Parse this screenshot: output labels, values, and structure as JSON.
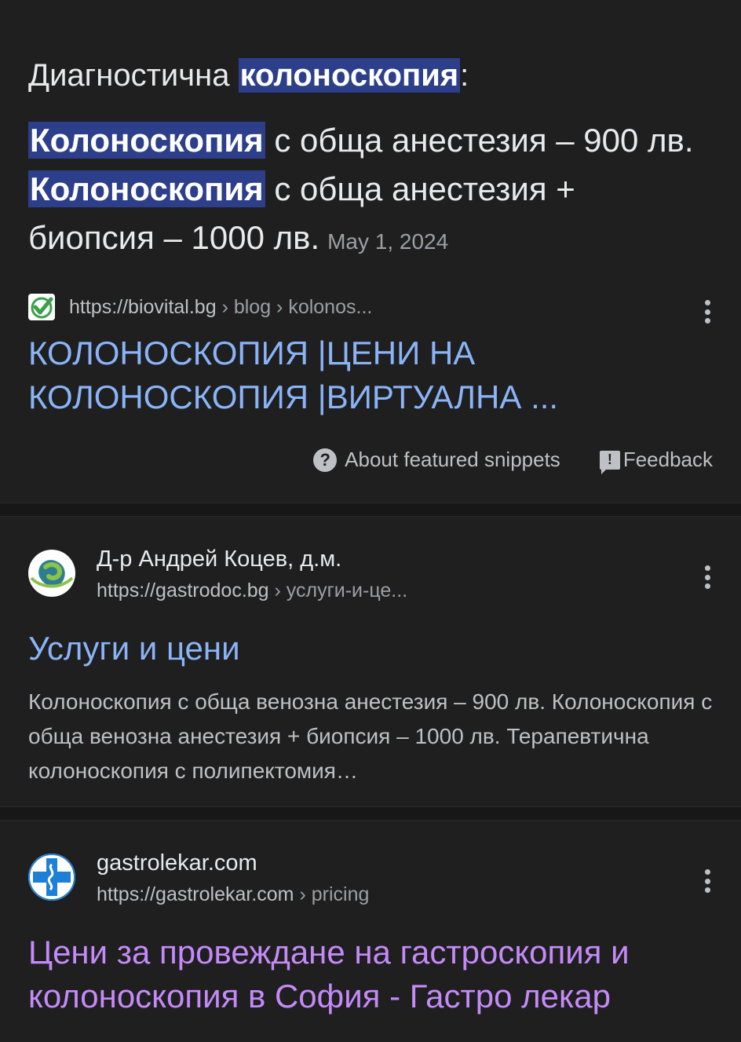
{
  "featured": {
    "heading_prefix": "Диагностична ",
    "heading_hl": "колоноскопия",
    "heading_suffix": ":",
    "answer_hl1": "Колоноскопия",
    "answer_t1": " с обща анестезия – 900 лв. ",
    "answer_hl2": "Колоноскопия",
    "answer_t2": " с обща анестезия + биопсия – 1000 лв.",
    "date": "May 1, 2024",
    "source_url": "https://biovital.bg",
    "source_path": " › blog › kolonos...",
    "title": "КОЛОНОСКОПИЯ |ЦЕНИ НА КОЛОНОСКОПИЯ |ВИРТУАЛНА ...",
    "about_label": "About featured snippets",
    "feedback_label": "Feedback"
  },
  "results": [
    {
      "site_name": "Д-р Андрей Коцев, д.м.",
      "url": "https://gastrodoc.bg",
      "path": " › услуги-и-це...",
      "title": "Услуги и цени",
      "desc": "Колоноскопия с обща венозна анестезия – 900 лв. Колоноскопия с обща венозна анестезия + биопсия – 1000 лв. Терапевтична колоноскопия с полипектомия…"
    },
    {
      "site_name": "gastrolekar.com",
      "url": "https://gastrolekar.com",
      "path": " › pricing",
      "title": "Цени за провеждане на гастроскопия и колоноскопия в София - Гастро лекар"
    }
  ],
  "colors": {
    "background": "#1f1f1f",
    "link": "#8ab4f8",
    "visited_link": "#c58af9",
    "highlight": "#2d3f8a"
  }
}
